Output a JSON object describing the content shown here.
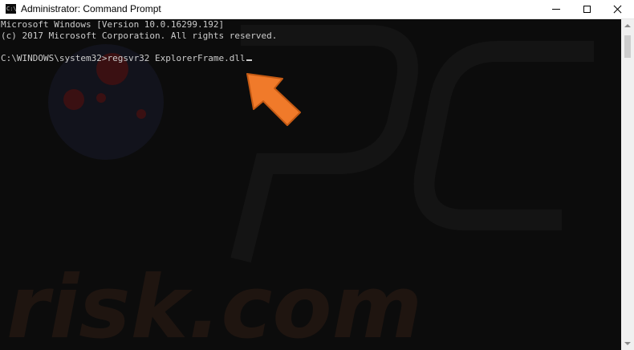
{
  "window": {
    "title": "Administrator: Command Prompt",
    "icon_text": "C:\\"
  },
  "console": {
    "lines": [
      "Microsoft Windows [Version 10.0.16299.192]",
      "(c) 2017 Microsoft Corporation. All rights reserved.",
      "C:\\WINDOWS\\system32>regsvr32 ExplorerFrame.dll"
    ]
  },
  "watermark": {
    "text": "risk.com"
  },
  "colors": {
    "console_bg": "#0c0c0c",
    "console_text": "#cccccc",
    "arrow": "#f07a2a",
    "watermark_accent": "#b01e23"
  }
}
